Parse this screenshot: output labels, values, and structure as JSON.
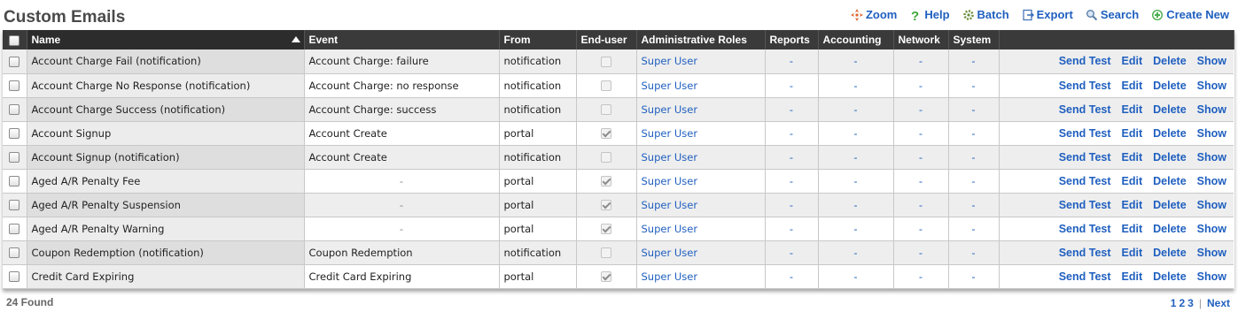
{
  "page_title": "Custom Emails",
  "toolbar": [
    {
      "name": "zoom-button",
      "icon": "zoom-icon",
      "label": "Zoom"
    },
    {
      "name": "help-button",
      "icon": "help-icon",
      "label": "Help"
    },
    {
      "name": "batch-button",
      "icon": "batch-icon",
      "label": "Batch"
    },
    {
      "name": "export-button",
      "icon": "export-icon",
      "label": "Export"
    },
    {
      "name": "search-button",
      "icon": "search-icon",
      "label": "Search"
    },
    {
      "name": "create-new-button",
      "icon": "add-icon",
      "label": "Create New"
    }
  ],
  "columns": {
    "name": "Name",
    "event": "Event",
    "from": "From",
    "end_user": "End-user",
    "admin_roles": "Administrative Roles",
    "reports": "Reports",
    "accounting": "Accounting",
    "network": "Network",
    "system": "System"
  },
  "rows": [
    {
      "name": "Account Charge Fail (notification)",
      "event": "Account Charge: failure",
      "from": "notification",
      "end_user": "disabled",
      "role": "Super User",
      "reports": "-",
      "accounting": "-",
      "network": "-",
      "system": "-"
    },
    {
      "name": "Account Charge No Response (notification)",
      "event": "Account Charge: no response",
      "from": "notification",
      "end_user": "disabled",
      "role": "Super User",
      "reports": "-",
      "accounting": "-",
      "network": "-",
      "system": "-"
    },
    {
      "name": "Account Charge Success (notification)",
      "event": "Account Charge: success",
      "from": "notification",
      "end_user": "disabled",
      "role": "Super User",
      "reports": "-",
      "accounting": "-",
      "network": "-",
      "system": "-"
    },
    {
      "name": "Account Signup",
      "event": "Account Create",
      "from": "portal",
      "end_user": "checked",
      "role": "Super User",
      "reports": "-",
      "accounting": "-",
      "network": "-",
      "system": "-"
    },
    {
      "name": "Account Signup (notification)",
      "event": "Account Create",
      "from": "notification",
      "end_user": "disabled",
      "role": "Super User",
      "reports": "-",
      "accounting": "-",
      "network": "-",
      "system": "-"
    },
    {
      "name": "Aged A/R Penalty Fee",
      "event": "-",
      "from": "portal",
      "end_user": "checked",
      "role": "Super User",
      "reports": "-",
      "accounting": "-",
      "network": "-",
      "system": "-"
    },
    {
      "name": "Aged A/R Penalty Suspension",
      "event": "-",
      "from": "portal",
      "end_user": "checked",
      "role": "Super User",
      "reports": "-",
      "accounting": "-",
      "network": "-",
      "system": "-"
    },
    {
      "name": "Aged A/R Penalty Warning",
      "event": "-",
      "from": "portal",
      "end_user": "checked",
      "role": "Super User",
      "reports": "-",
      "accounting": "-",
      "network": "-",
      "system": "-"
    },
    {
      "name": "Coupon Redemption (notification)",
      "event": "Coupon Redemption",
      "from": "notification",
      "end_user": "disabled",
      "role": "Super User",
      "reports": "-",
      "accounting": "-",
      "network": "-",
      "system": "-"
    },
    {
      "name": "Credit Card Expiring",
      "event": "Credit Card Expiring",
      "from": "portal",
      "end_user": "checked",
      "role": "Super User",
      "reports": "-",
      "accounting": "-",
      "network": "-",
      "system": "-"
    }
  ],
  "row_actions": {
    "send_test": "Send Test",
    "edit": "Edit",
    "delete": "Delete",
    "show": "Show"
  },
  "footer": {
    "count": "24 Found",
    "pages": [
      "1",
      "2",
      "3"
    ],
    "current_page": "1",
    "next": "Next"
  },
  "colors": {
    "link": "#1f5fbf",
    "header_bg": "#3a3a3a"
  }
}
